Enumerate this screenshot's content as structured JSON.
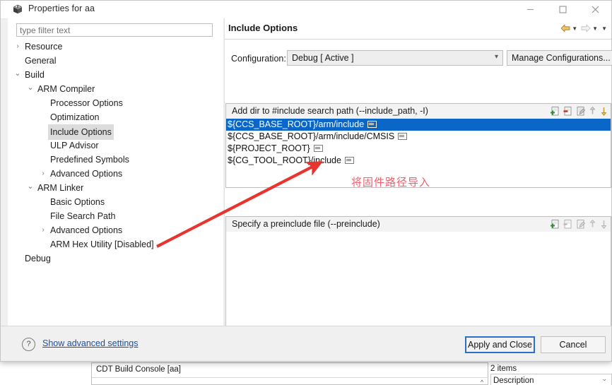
{
  "window": {
    "title": "Properties for aa",
    "icon": "package-icon",
    "minimize": "minimize-icon",
    "maximize": "maximize-icon",
    "close": "close-icon"
  },
  "filter": {
    "placeholder": "type filter text",
    "value": ""
  },
  "tree": {
    "items": [
      {
        "label": "Resource",
        "indent": 0,
        "arrow": "collapsed",
        "selected": false
      },
      {
        "label": "General",
        "indent": 0,
        "arrow": "none",
        "selected": false
      },
      {
        "label": "Build",
        "indent": 0,
        "arrow": "expanded",
        "selected": false
      },
      {
        "label": "ARM Compiler",
        "indent": 1,
        "arrow": "expanded",
        "selected": false
      },
      {
        "label": "Processor Options",
        "indent": 2,
        "arrow": "none",
        "selected": false
      },
      {
        "label": "Optimization",
        "indent": 2,
        "arrow": "none",
        "selected": false
      },
      {
        "label": "Include Options",
        "indent": 2,
        "arrow": "none",
        "selected": true
      },
      {
        "label": "ULP Advisor",
        "indent": 2,
        "arrow": "none",
        "selected": false
      },
      {
        "label": "Predefined Symbols",
        "indent": 2,
        "arrow": "none",
        "selected": false
      },
      {
        "label": "Advanced Options",
        "indent": 2,
        "arrow": "collapsed",
        "selected": false
      },
      {
        "label": "ARM Linker",
        "indent": 1,
        "arrow": "expanded",
        "selected": false
      },
      {
        "label": "Basic Options",
        "indent": 2,
        "arrow": "none",
        "selected": false
      },
      {
        "label": "File Search Path",
        "indent": 2,
        "arrow": "none",
        "selected": false
      },
      {
        "label": "Advanced Options",
        "indent": 2,
        "arrow": "collapsed",
        "selected": false
      },
      {
        "label": "ARM Hex Utility  [Disabled]",
        "indent": 2,
        "arrow": "none",
        "selected": false
      },
      {
        "label": "Debug",
        "indent": 0,
        "arrow": "none",
        "selected": false
      }
    ]
  },
  "panel": {
    "title": "Include Options",
    "nav": {
      "back": "back-arrow-icon",
      "back_menu": "chevron-down-icon",
      "forward": "forward-arrow-icon",
      "forward_menu": "chevron-down-icon",
      "overflow_menu": "chevron-down-icon"
    }
  },
  "configuration": {
    "label": "Configuration:",
    "selected": "Debug  [ Active ]",
    "options": [
      "Debug  [ Active ]"
    ],
    "manage_button": "Manage Configurations..."
  },
  "include_paths": {
    "header": "Add dir to #include search path (--include_path, -I)",
    "tools": [
      "add-icon",
      "delete-icon",
      "edit-icon",
      "move-up-icon",
      "move-down-icon"
    ],
    "rows": [
      {
        "text": "${CCS_BASE_ROOT}/arm/include",
        "badge": true,
        "selected": true
      },
      {
        "text": "${CCS_BASE_ROOT}/arm/include/CMSIS",
        "badge": true,
        "selected": false
      },
      {
        "text": "${PROJECT_ROOT}",
        "badge": true,
        "selected": false
      },
      {
        "text": "${CG_TOOL_ROOT}/include",
        "badge": true,
        "selected": false
      }
    ]
  },
  "preinclude": {
    "header": "Specify a preinclude file (--preinclude)",
    "tools": [
      "add-icon",
      "delete-icon",
      "edit-icon",
      "move-up-icon",
      "move-down-icon"
    ],
    "rows": []
  },
  "footer": {
    "help": "help-icon",
    "advanced_link": "Show advanced settings",
    "apply_button": "Apply and Close",
    "cancel_button": "Cancel"
  },
  "annotation": {
    "text": "将固件路径导入",
    "color": "#e8616f",
    "arrow_color": "#e8332e"
  },
  "background": {
    "console_title": "CDT Build Console [aa]",
    "items_count": "2 items",
    "description_header": "Description"
  }
}
